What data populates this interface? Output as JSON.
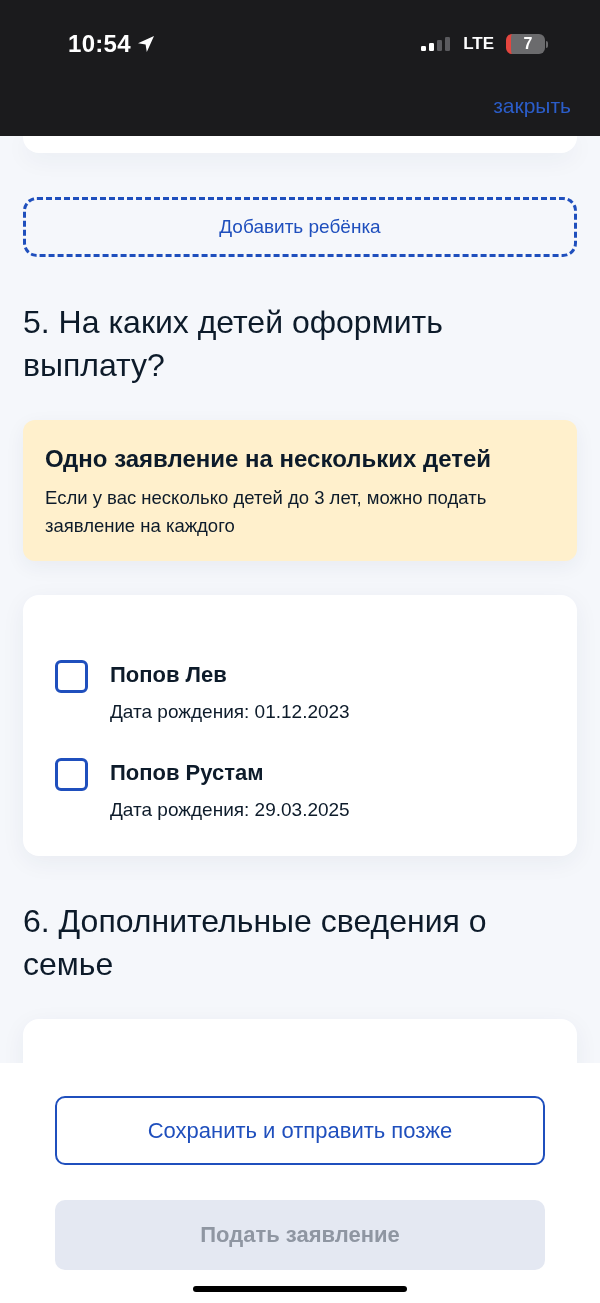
{
  "status_bar": {
    "time": "10:54",
    "network": "LTE",
    "battery": "7"
  },
  "header": {
    "close_link": "закрыть"
  },
  "add_child_button": "Добавить ребёнка",
  "sections": [
    {
      "title": "5. На каких детей оформить выплату?",
      "notice": {
        "title": "Одно заявление на нескольких детей",
        "text": "Если у вас несколько детей до 3 лет, можно подать заявление на каждого"
      },
      "options": [
        {
          "name": "Попов Лев",
          "birth_date": "Дата рождения: 01.12.2023",
          "checked": false
        },
        {
          "name": "Попов Рустам",
          "birth_date": "Дата рождения: 29.03.2025",
          "checked": false
        }
      ]
    },
    {
      "title": "6. Дополнительные сведения о семье"
    }
  ],
  "footer": {
    "buttons": [
      {
        "label": "Сохранить и отправить позже",
        "kind": "outline",
        "disabled": false
      },
      {
        "label": "Подать заявление",
        "kind": "primary",
        "disabled": true
      }
    ]
  }
}
